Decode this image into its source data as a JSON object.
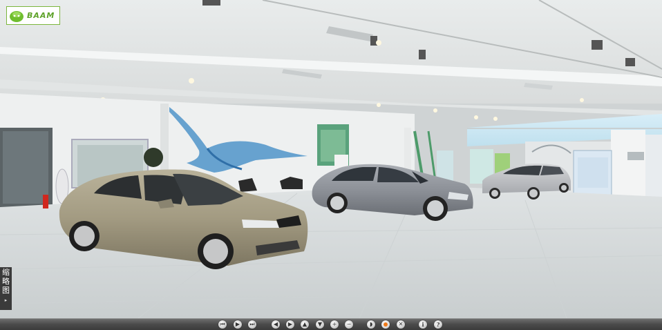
{
  "logo": {
    "text": "BAAM",
    "icon": "green-mascot-icon"
  },
  "thumbnail_tab": {
    "chars": [
      "缩",
      "略",
      "图"
    ],
    "arrow": "▸"
  },
  "toolbar": {
    "buttons": [
      {
        "name": "first-scene-button",
        "glyph": "⏮",
        "icon": "skip-back-icon"
      },
      {
        "name": "play-button",
        "glyph": "▶",
        "icon": "play-icon"
      },
      {
        "name": "last-scene-button",
        "glyph": "⏭",
        "icon": "skip-forward-icon"
      },
      {
        "name": "pan-left-button",
        "glyph": "◀",
        "icon": "arrow-left-icon"
      },
      {
        "name": "pan-right-button",
        "glyph": "▶",
        "icon": "arrow-right-icon"
      },
      {
        "name": "pan-up-button",
        "glyph": "▲",
        "icon": "arrow-up-icon"
      },
      {
        "name": "pan-down-button",
        "glyph": "▼",
        "icon": "arrow-down-icon"
      },
      {
        "name": "zoom-in-button",
        "glyph": "+",
        "icon": "plus-icon"
      },
      {
        "name": "zoom-out-button",
        "glyph": "−",
        "icon": "minus-icon"
      },
      {
        "name": "sound-button",
        "glyph": "◗",
        "icon": "speaker-icon"
      },
      {
        "name": "autorotate-button",
        "glyph": "",
        "icon": "record-dot-icon"
      },
      {
        "name": "fullscreen-button",
        "glyph": "✕",
        "icon": "fullscreen-icon"
      },
      {
        "name": "info-button",
        "glyph": "i",
        "icon": "info-icon"
      },
      {
        "name": "help-button",
        "glyph": "?",
        "icon": "help-icon"
      }
    ]
  },
  "colors": {
    "accent_green": "#5ea22a",
    "toolbar_bg": "#4a4a4a",
    "active_dot": "#f07a1a"
  }
}
